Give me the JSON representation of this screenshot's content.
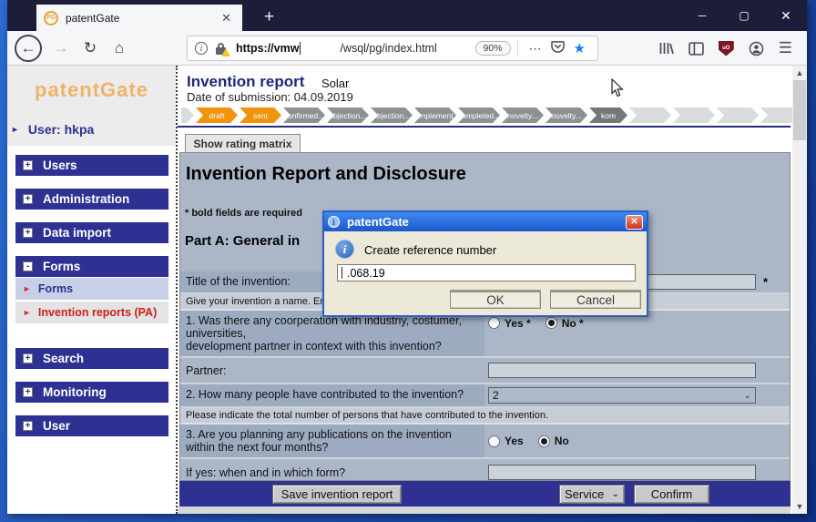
{
  "icons": {
    "close": "✕",
    "minimize": "─",
    "maximize": "▢",
    "plus": "+",
    "back": "←",
    "forward": "→",
    "reload": "↻",
    "home": "⌂",
    "dots": "⋯",
    "star": "★",
    "menu": "☰",
    "info_i": "i",
    "select_chevron": "⌄",
    "scroll_up": "▲",
    "scroll_down": "▼",
    "tri_right": "►"
  },
  "browser": {
    "tab": {
      "title": "patentGate",
      "favicon_text": "PG"
    },
    "url": {
      "scheme_host": "https://vmw",
      "path": "/wsql/pg/index.html",
      "zoom_level": "90%"
    },
    "ublock_label": "uO"
  },
  "sidebar": {
    "logo": "patentGate",
    "user": "User: hkpa",
    "menus": [
      {
        "label": "Users",
        "state_icon": "+"
      },
      {
        "label": "Administration",
        "state_icon": "+"
      },
      {
        "label": "Data import",
        "state_icon": "+"
      },
      {
        "label": "Forms",
        "state_icon": "-"
      },
      {
        "label": "Search",
        "state_icon": "+"
      },
      {
        "label": "Monitoring",
        "state_icon": "+"
      },
      {
        "label": "User",
        "state_icon": "+"
      }
    ],
    "submenu": [
      {
        "label": "Forms"
      },
      {
        "label": "Invention reports (PA)"
      }
    ]
  },
  "header": {
    "title": "Invention report",
    "subtitle": "Solar",
    "date_line": "Date of submission: 04.09.2019"
  },
  "breadcrumbs": {
    "items": [
      {
        "label": "draft",
        "state": "active"
      },
      {
        "label": "sent",
        "state": "active"
      },
      {
        "label": "confirmed...",
        "state": "done"
      },
      {
        "label": "objection...",
        "state": "done"
      },
      {
        "label": "objection...",
        "state": "done"
      },
      {
        "label": "complement...",
        "state": "done"
      },
      {
        "label": "completed...",
        "state": "done"
      },
      {
        "label": "novelty...",
        "state": "done"
      },
      {
        "label": "novelty...",
        "state": "done"
      },
      {
        "label": "kom",
        "state": "current"
      }
    ]
  },
  "tabs": {
    "rating_matrix": "Show rating matrix"
  },
  "form": {
    "title": "Invention Report and Disclosure",
    "required_note": "* bold fields are required",
    "section": "Part A: General in",
    "rows": {
      "title": {
        "label": "Title of the invention:",
        "value": "",
        "required": "*",
        "hint": "Give your invention a name. Er"
      },
      "q1": {
        "label": "1. Was there any coorperation with industriy, costumer, universities,\ndevelopment partner in context with this invention?",
        "yes": "Yes *",
        "no": "No *",
        "selected": "No"
      },
      "partner": {
        "label": "Partner:",
        "value": ""
      },
      "q2": {
        "label": "2. How many people have contributed to the invention?",
        "value": "2",
        "hint": "Please indicate the total number of persons that have contributed to the invention."
      },
      "q3": {
        "label": "3. Are you planning any publications on the invention within the next four months?",
        "yes": "Yes",
        "no": "No",
        "selected": "No"
      },
      "ifyes": {
        "label": "If yes: when and in which form?",
        "value": ""
      }
    },
    "actions": {
      "save": "Save invention report",
      "service": "Service",
      "confirm": "Confirm"
    }
  },
  "dialog": {
    "title": "patentGate",
    "message": "Create reference number",
    "input_value": ".068.19",
    "ok": "OK",
    "cancel": "Cancel"
  }
}
